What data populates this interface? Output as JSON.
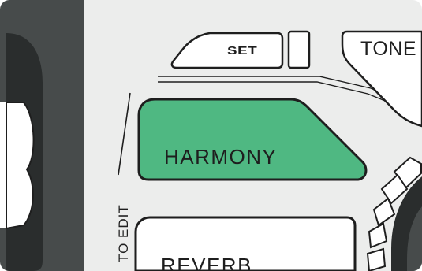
{
  "buttons": {
    "set": "SET",
    "tone": "TONE",
    "harmony": "HARMONY",
    "reverb": "REVERB"
  },
  "side_label": "TO EDIT",
  "colors": {
    "harmony_active": "#4fb882",
    "panel": "#ecedec",
    "outline": "#1e1e1e",
    "dark_rail": "#474b4b"
  }
}
